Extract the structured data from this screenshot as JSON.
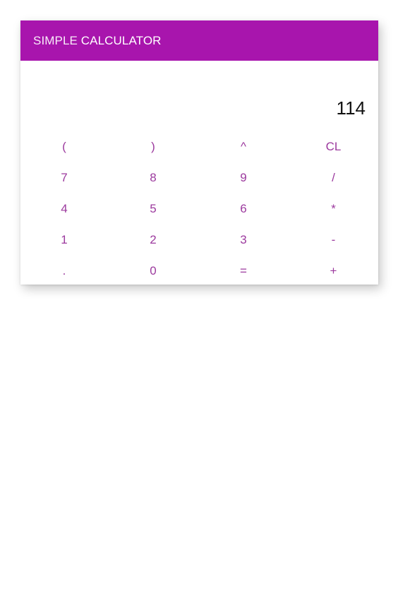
{
  "header": {
    "title_light": "SIMPLE ",
    "title_bold": "CALCULATOR",
    "color": "#a815ad"
  },
  "display": {
    "value": "114"
  },
  "keys": {
    "accent_color": "#9c3a9e",
    "rows": [
      [
        "(",
        ")",
        "^",
        "CL"
      ],
      [
        "7",
        "8",
        "9",
        "/"
      ],
      [
        "4",
        "5",
        "6",
        "*"
      ],
      [
        "1",
        "2",
        "3",
        "-"
      ],
      [
        ".",
        "0",
        "=",
        "+"
      ]
    ]
  }
}
